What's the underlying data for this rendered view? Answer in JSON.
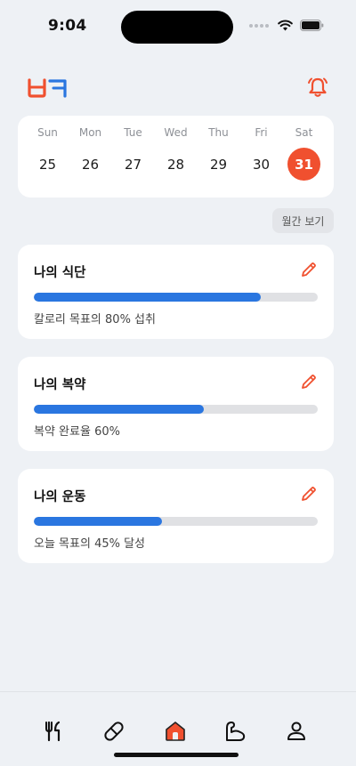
{
  "status_bar": {
    "time": "9:04"
  },
  "colors": {
    "accent": "#f0502f",
    "progress": "#2a76e0",
    "background": "#eef1f5"
  },
  "header": {
    "logo_icon": "app-logo-icon",
    "notification_icon": "bell-icon"
  },
  "calendar": {
    "days": [
      {
        "name": "Sun",
        "date": "25"
      },
      {
        "name": "Mon",
        "date": "26"
      },
      {
        "name": "Tue",
        "date": "27"
      },
      {
        "name": "Wed",
        "date": "28"
      },
      {
        "name": "Thu",
        "date": "29"
      },
      {
        "name": "Fri",
        "date": "30"
      },
      {
        "name": "Sat",
        "date": "31"
      }
    ],
    "selected_date": "31",
    "monthly_view_label": "월간 보기"
  },
  "cards": [
    {
      "title": "나의 식단",
      "progress": 0.8,
      "description": "칼로리 목표의 80% 섭취",
      "edit_icon": "pencil-icon"
    },
    {
      "title": "나의 복약",
      "progress": 0.6,
      "description": "복약 완료율 60%",
      "edit_icon": "pencil-icon"
    },
    {
      "title": "나의 운동",
      "progress": 0.45,
      "description": "오늘 목표의 45% 달성",
      "edit_icon": "pencil-icon"
    }
  ],
  "bottom_nav": {
    "items": [
      {
        "icon": "fork-knife-icon"
      },
      {
        "icon": "pill-icon"
      },
      {
        "icon": "home-icon",
        "active": true
      },
      {
        "icon": "arm-muscle-icon"
      },
      {
        "icon": "person-icon"
      }
    ]
  }
}
